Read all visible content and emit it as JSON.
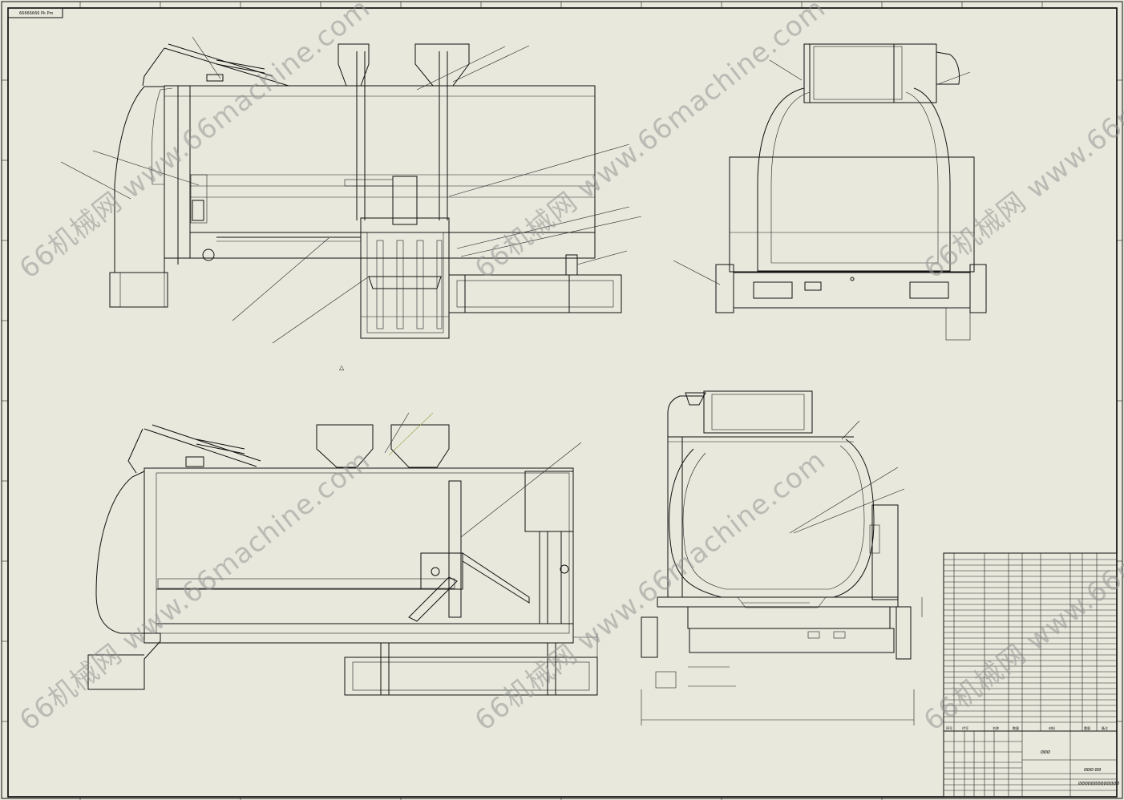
{
  "drawing": {
    "header_label": "66666666 Pk Pm",
    "watermark_text": "66机械网 www.66machine.com",
    "center_mark": "△",
    "title_block_center": "ØØØ",
    "title_block_name": "ØØØ ØØ",
    "title_block_code": "ØØØØØØØØØØØØØ",
    "bom_header": [
      "序号",
      "代号",
      "名称",
      "数量",
      "材料",
      "重量",
      "备注"
    ],
    "bom_rows": 30
  },
  "colors": {
    "background": "#e8e8dc",
    "line": "#111111",
    "watermark": "#969696"
  }
}
